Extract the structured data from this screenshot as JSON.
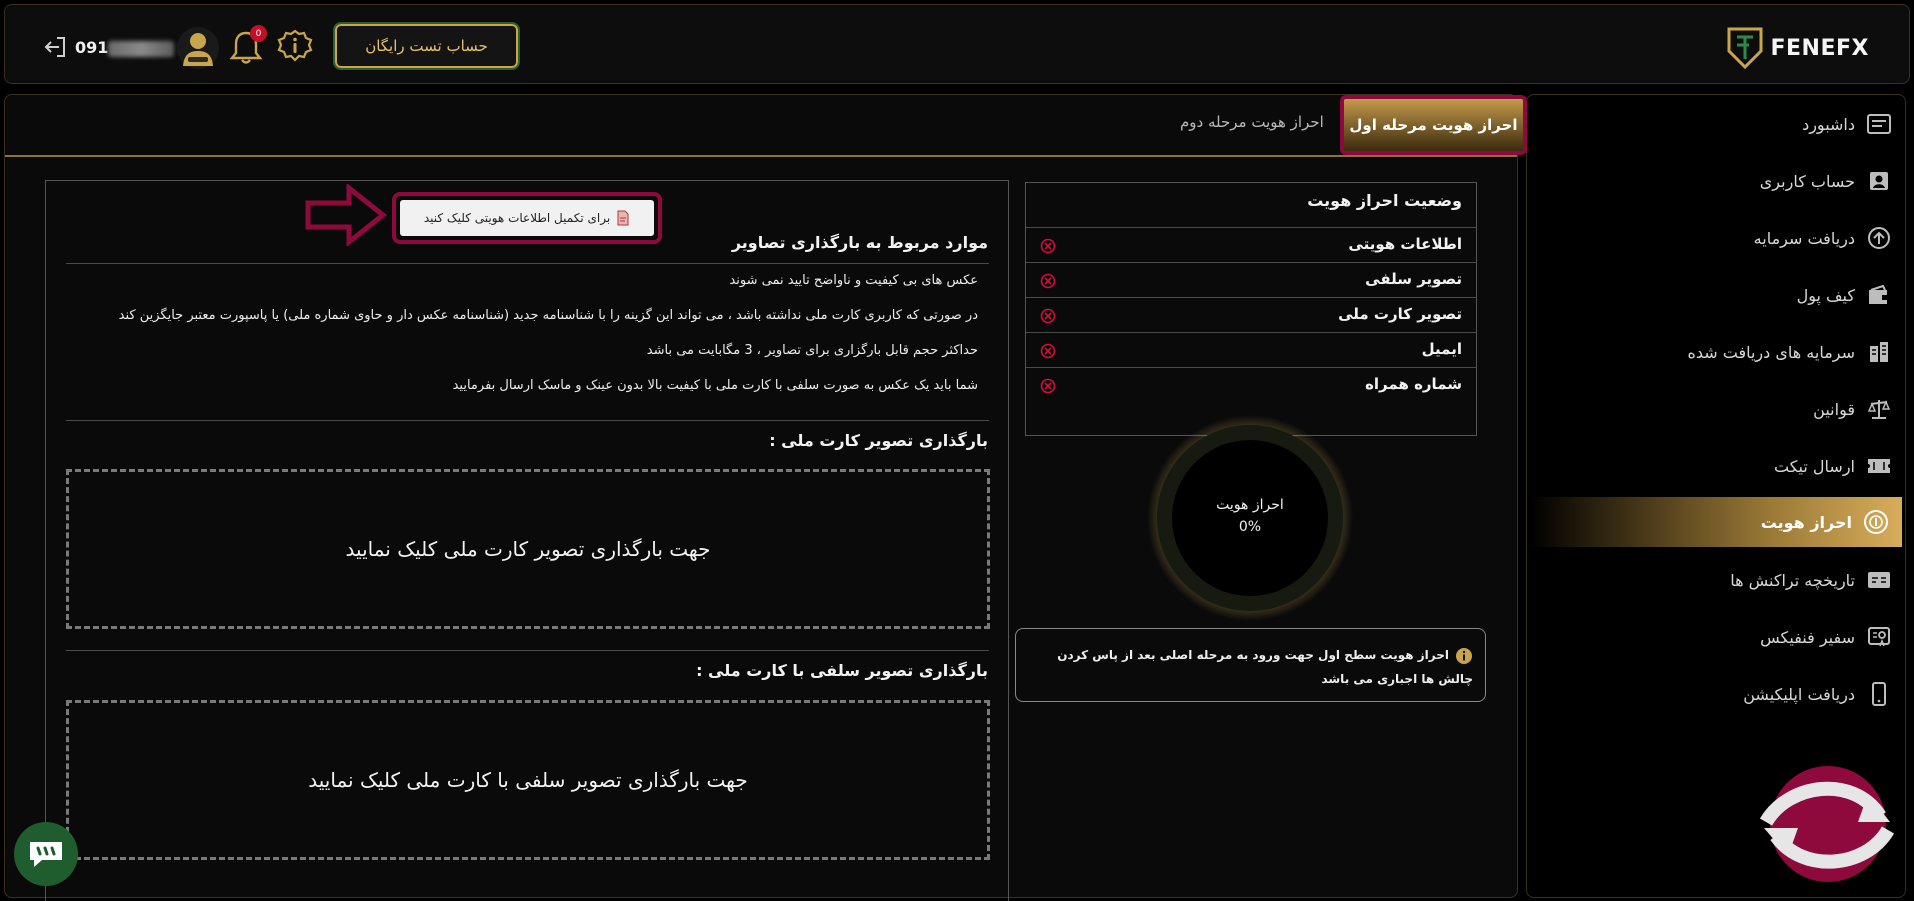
{
  "header": {
    "logo_text": "FENEFX",
    "trial_button": "حساب تست رایگان",
    "notification_count": "0",
    "phone_prefix": "091"
  },
  "sidebar": {
    "items": [
      {
        "label": "داشبورد",
        "icon": "dashboard-icon"
      },
      {
        "label": "حساب کاربری",
        "icon": "user-card-icon"
      },
      {
        "label": "دریافت سرمایه",
        "icon": "capital-icon"
      },
      {
        "label": "کیف پول",
        "icon": "wallet-icon"
      },
      {
        "label": "سرمایه های دریافت شده",
        "icon": "buildings-icon"
      },
      {
        "label": "قوانین",
        "icon": "scale-icon"
      },
      {
        "label": "ارسال تیکت",
        "icon": "ticket-icon"
      },
      {
        "label": "احراز هویت",
        "icon": "fingerprint-icon",
        "active": true
      },
      {
        "label": "تاریخچه تراکنش ها",
        "icon": "transactions-icon"
      },
      {
        "label": "سفیر فنفیکس",
        "icon": "ambassador-icon"
      },
      {
        "label": "دریافت اپلیکیشن",
        "icon": "mobile-icon"
      }
    ]
  },
  "tabs": {
    "first": "احراز هویت مرحله اول",
    "second": "احراز هویت مرحله دوم"
  },
  "upload": {
    "id_button": "برای تکمیل اطلاعات هویتی کلیک کنید",
    "rules_title": "موارد مربوط به بارگذاری تصاویر",
    "rules": [
      "عکس های بی کیفیت و ناواضح تایید نمی شوند",
      "در صورتی که کاربری کارت ملی نداشته باشد ، می تواند این گزینه را با شناسنامه جدید (شناسنامه عکس دار و حاوی شماره ملی) یا پاسپورت معتبر جایگزین کند",
      "حداکثر حجم قابل بارگزاری برای تصاویر ، 3 مگابایت می باشد",
      "شما باید یک عکس به صورت سلفی با کارت ملی با کیفیت بالا بدون عینک و ماسک ارسال بفرمایید"
    ],
    "national_card_title": "بارگذاری تصویر کارت ملی :",
    "national_card_drop": "جهت بارگذاری تصویر کارت ملی کلیک نمایید",
    "selfie_title": "بارگذاری تصویر سلفی با کارت ملی :",
    "selfie_drop": "جهت بارگذاری تصویر سلفی با کارت ملی کلیک نمایید"
  },
  "status": {
    "title": "وضعیت احراز هویت",
    "rows": [
      "اطلاعات هویتی",
      "تصویر سلفی",
      "تصویر کارت ملی",
      "ایمیل",
      "شماره همراه"
    ],
    "gauge_label": "احراز هویت",
    "gauge_value": "0%",
    "progress": 0,
    "note": "احراز هویت سطح اول جهت ورود به مرحله اصلی بعد از پاس کردن چالش ها اجباری می باشد"
  },
  "colors": {
    "accent_gold": "#c9a64b",
    "highlight_magenta": "#8e0a3c",
    "error_red": "#d0103a"
  }
}
